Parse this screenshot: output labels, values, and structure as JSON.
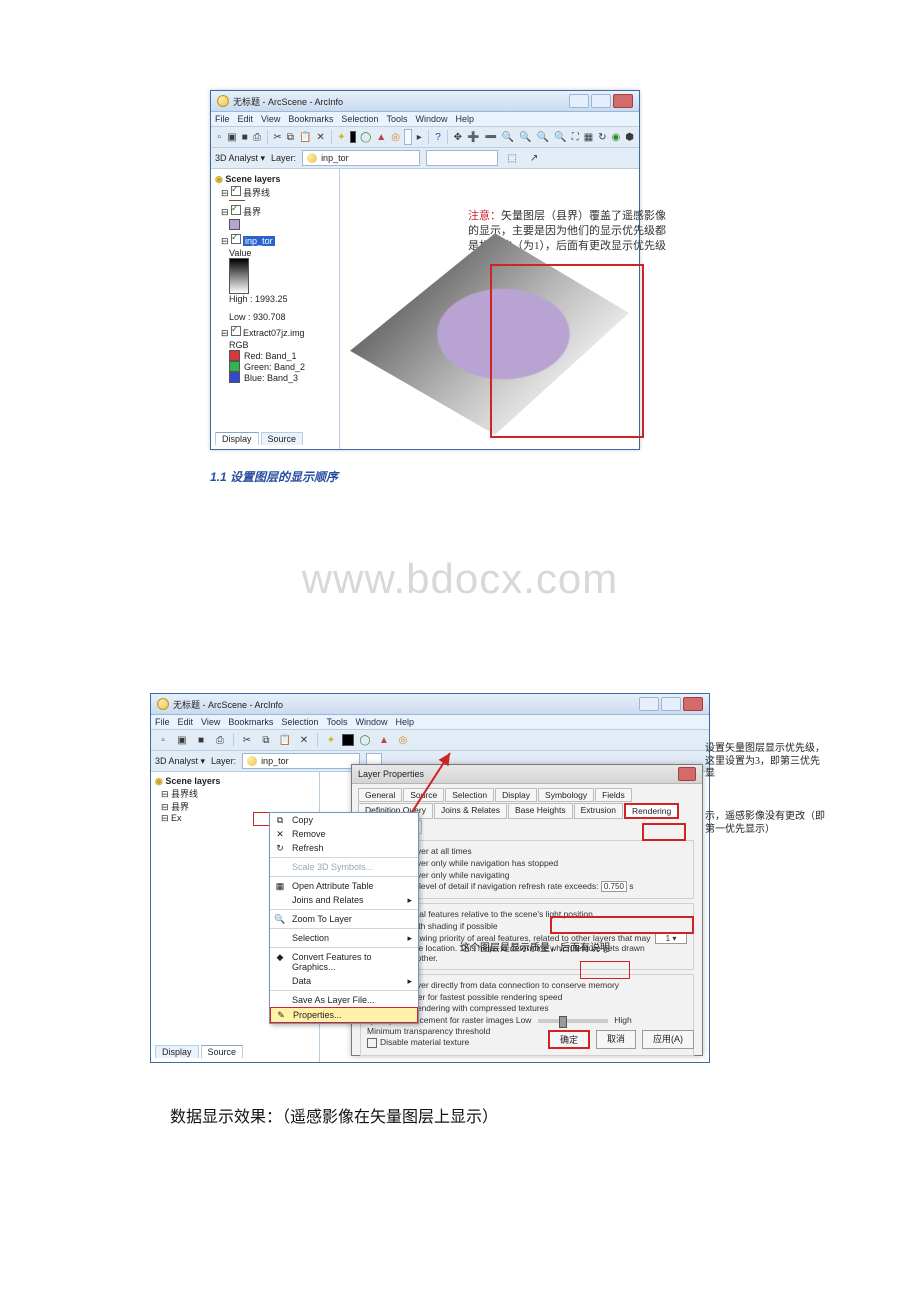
{
  "watermark": "www.bdocx.com",
  "screenshot1": {
    "title": "无标题 - ArcScene - ArcInfo",
    "menus": [
      "File",
      "Edit",
      "View",
      "Bookmarks",
      "Selection",
      "Tools",
      "Window",
      "Help"
    ],
    "analyst_label": "3D Analyst ▾",
    "layer_label": "Layer:",
    "layer_value": "inp_tor",
    "toc_root": "Scene layers",
    "toc_layer1": "县界线",
    "toc_layer2": "县界",
    "toc_layer3": "inp_tor",
    "value_label": "Value",
    "high_label": "High : 1993.25",
    "low_label": "Low : 930.708",
    "toc_layer4": "Extract07jz.img",
    "rgb_label": "RGB",
    "band_r": "Red: Band_1",
    "band_g": "Green: Band_2",
    "band_b": "Blue: Band_3",
    "tab_display": "Display",
    "tab_source": "Source",
    "annotation_hl": "注意：",
    "annotation": "矢量图层（县界）覆盖了遥感影像的显示，主要是因为他们的显示优先级都是相同的（为1），后面有更改显示优先级的步骤"
  },
  "caption1": "1.1 设置图层的显示顺序",
  "screenshot2": {
    "title": "无标题 - ArcScene - ArcInfo",
    "menus": [
      "File",
      "Edit",
      "View",
      "Bookmarks",
      "Selection",
      "Tools",
      "Window",
      "Help"
    ],
    "analyst_label": "3D Analyst ▾",
    "layer_label": "Layer:",
    "layer_value": "inp_tor",
    "toc_root": "Scene layers",
    "toc_layer1": "县界线",
    "toc_layer2": "县界",
    "toc_layer4": "Ex",
    "tab_display": "Display",
    "tab_source": "Source",
    "ctx": {
      "copy": "Copy",
      "remove": "Remove",
      "refresh": "Refresh",
      "scale3d": "Scale 3D Symbols...",
      "openattr": "Open Attribute Table",
      "joins": "Joins and Relates",
      "zoom": "Zoom To Layer",
      "selection": "Selection",
      "convert": "Convert Features to Graphics...",
      "data": "Data",
      "saveas": "Save As Layer File...",
      "props": "Properties..."
    },
    "dlg": {
      "title": "Layer Properties",
      "tabs": [
        "General",
        "Source",
        "Selection",
        "Display",
        "Symbology",
        "Fields",
        "Definition Query",
        "Joins & Relates",
        "Base Heights",
        "Extrusion",
        "Rendering",
        "HTML Popup"
      ],
      "grp_visibility": "Visibility",
      "vis_opt1": "Render layer at all times",
      "vis_opt2": "Render layer only while navigation has stopped",
      "vis_opt3": "Render layer only while navigating",
      "vis_draw": "Draw simpler level of detail if navigation refresh rate exceeds:",
      "vis_val": "0.750",
      "grp_effects": "Effects",
      "eff_shade": "Shade areal features relative to the scene's light position",
      "eff_smooth": "Use smooth shading if possible",
      "eff_priority": "Select the drawing priority of areal features, related to other layers that may be at the same location. This helps to determine which feature gets drawn on top of the other.",
      "grp_optimize": "Optimize",
      "opt_direct": "Render layer directly from data connection to conserve memory",
      "opt_cache": "Cache layer for fastest possible rendering speed",
      "opt_compressed": "Disable Rendering with compressed textures",
      "opt_quality": "Quality enhancement for raster images",
      "opt_low": "Low",
      "opt_high": "High",
      "opt_min": "Minimum transparency threshold",
      "opt_disable": "Disable material texture",
      "btn_ok": "确定",
      "btn_cancel": "取消",
      "btn_apply": "应用(A)"
    },
    "ann_a": "设置矢量图层显示优先级，这里设置为3，即第三优先显",
    "ann_b": "示，遥感影像没有更改（即第一优先显示）",
    "ann_c": "这个图层是显示质量，后面有说明"
  },
  "bodytext": "数据显示效果：（遥感影像在矢量图层上显示）"
}
